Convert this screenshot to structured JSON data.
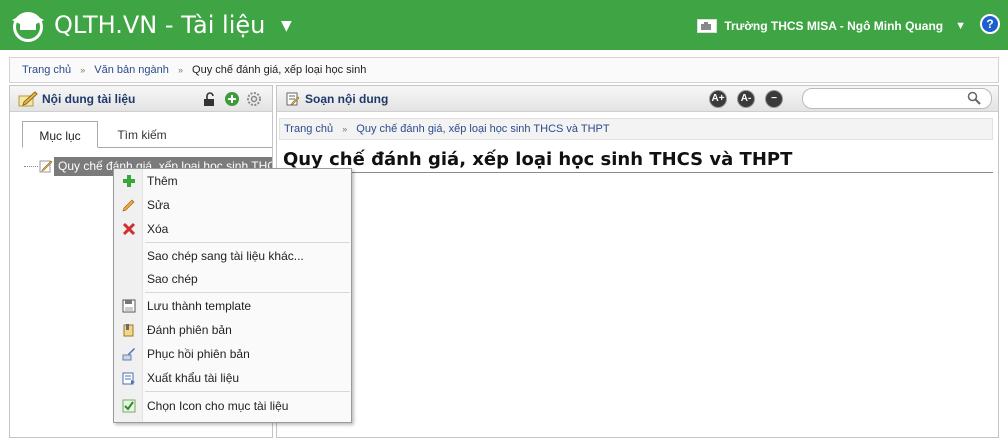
{
  "app": {
    "brand": "QLTH.VN",
    "section": "Tài liệu",
    "dropdown_glyph": "▼"
  },
  "user": {
    "school_user": "Trường THCS MISA - Ngô Minh Quang",
    "help_label": "?"
  },
  "breadcrumb": {
    "items": [
      "Trang chủ",
      "Văn bản ngành",
      "Quy chế đánh giá, xếp loại học sinh"
    ],
    "separator": "»"
  },
  "left_panel": {
    "title": "Nội dung tài liệu",
    "tabs": [
      {
        "label": "Mục lục",
        "active": true
      },
      {
        "label": "Tìm kiếm",
        "active": false
      }
    ],
    "tree_node": "Quy chế đánh giá, xếp loại học sinh THCS và THPT"
  },
  "right_panel": {
    "title": "Soạn nội dung",
    "font_buttons": [
      "A+",
      "A-",
      "−"
    ],
    "search": {
      "value": "",
      "placeholder": ""
    },
    "breadcrumb": [
      "Trang chủ",
      "Quy chế đánh giá, xếp loại học sinh THCS và THPT"
    ],
    "doc_title": "Quy chế đánh giá, xếp loại học sinh THCS và THPT"
  },
  "context_menu": {
    "items": [
      {
        "label": "Thêm",
        "icon": "plus-icon"
      },
      {
        "label": "Sửa",
        "icon": "pencil-icon"
      },
      {
        "label": "Xóa",
        "icon": "delete-x-icon"
      },
      {
        "label": "Sao chép sang tài liệu khác...",
        "icon": ""
      },
      {
        "label": "Sao chép",
        "icon": ""
      },
      {
        "label": "Lưu thành template",
        "icon": "save-template-icon"
      },
      {
        "label": "Đánh phiên bản",
        "icon": "version-icon"
      },
      {
        "label": "Phục hồi phiên bản",
        "icon": "restore-icon"
      },
      {
        "label": "Xuất khẩu tài liệu",
        "icon": "export-icon"
      },
      {
        "label": "Chọn Icon cho mục tài liệu",
        "icon": "choose-icon-icon"
      }
    ]
  },
  "colors": {
    "topbar": "#3fa443",
    "link": "#2a4c8c",
    "selected_node": "#7b7b7b"
  }
}
